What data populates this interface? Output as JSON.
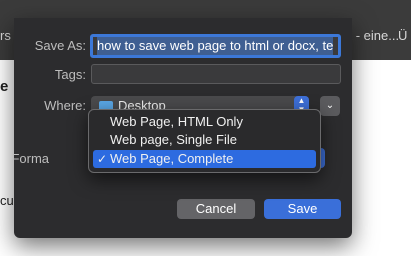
{
  "background": {
    "left_fragment": "rs",
    "right_fragment": "xt - eine...",
    "far_right_fragment": "Ü",
    "heading_fragment": "e",
    "body_fragment": "cu"
  },
  "dialog": {
    "save_as_label": "Save As:",
    "save_as_value": "how to save web page to html or docx, te",
    "tags_label": "Tags:",
    "tags_value": "",
    "where_label": "Where:",
    "where_value": "Desktop",
    "format_label": "Forma",
    "cancel_label": "Cancel",
    "save_label": "Save"
  },
  "format_menu": {
    "items": [
      {
        "label": "Web Page, HTML Only",
        "selected": false
      },
      {
        "label": "Web page, Single File",
        "selected": false
      },
      {
        "label": "Web Page, Complete",
        "selected": true
      }
    ],
    "checkmark": "✓"
  },
  "colors": {
    "accent": "#3a6fd9",
    "sheet": "#2c2c2e",
    "menu_selected": "#2d6be0"
  }
}
